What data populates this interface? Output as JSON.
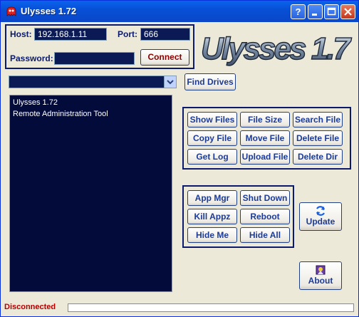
{
  "window": {
    "title": "Ulysses 1.72"
  },
  "connection": {
    "host_label": "Host:",
    "host_value": "192.168.1.11",
    "port_label": "Port:",
    "port_value": "666",
    "password_label": "Password:",
    "password_value": "",
    "connect_label": "Connect"
  },
  "logo_text": "Ulysses 1.7",
  "drives": {
    "selected": "",
    "find_label": "Find Drives"
  },
  "output_lines": [
    "Ulysses 1.72",
    "Remote Administration Tool"
  ],
  "file_buttons": [
    "Show Files",
    "File Size",
    "Search File",
    "Copy File",
    "Move File",
    "Delete File",
    "Get Log",
    "Upload File",
    "Delete Dir"
  ],
  "app_buttons": [
    "App Mgr",
    "Shut Down",
    "Kill Appz",
    "Reboot",
    "Hide Me",
    "Hide All"
  ],
  "update_label": "Update",
  "about_label": "About",
  "status": {
    "text": "Disconnected",
    "progress": 0
  },
  "colors": {
    "navy": "#0b1a6b",
    "field_bg": "#0b1a55",
    "title_blue": "#0750d6",
    "status_red": "#b30000"
  },
  "icons": {
    "update": "refresh-icon",
    "about": "about-icon",
    "app": "app-icon"
  }
}
